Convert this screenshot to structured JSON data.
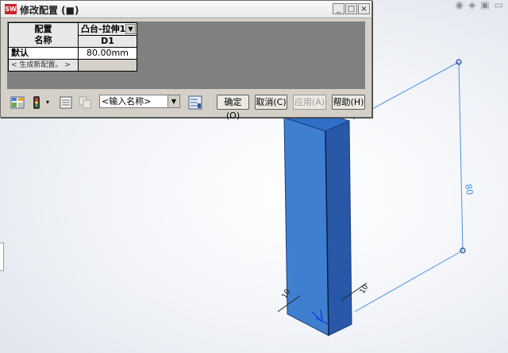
{
  "window": {
    "app_icon_label": "SW",
    "title": "修改配置 (■)",
    "minimize_label": "_",
    "maximize_label": "□",
    "close_label": "×"
  },
  "table": {
    "corner_header": "配置\n名称",
    "feature_dropdown": "凸台-拉伸1",
    "param_header": "D1",
    "rows": [
      {
        "name": "默认",
        "value": "80.00mm"
      },
      {
        "name": "< 生成新配置。 >",
        "value": ""
      }
    ]
  },
  "toolbar": {
    "name_combo_value": "<输入名称>",
    "ok_label": "确定(O)",
    "cancel_label": "取消(C)",
    "apply_label": "应用(A)",
    "help_label": "帮助(H)"
  },
  "model": {
    "dimension_80": "80",
    "dimension_10": "10",
    "dimension_10b": "10",
    "face_color": "#3f7fcf"
  }
}
